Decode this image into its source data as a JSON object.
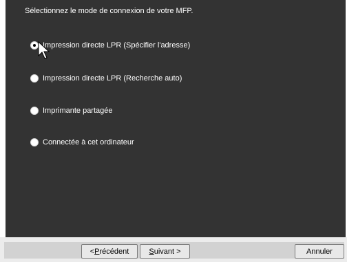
{
  "panel": {
    "instruction": "Sélectionnez le mode de connexion de votre MFP."
  },
  "options": [
    {
      "label": "Impression directe LPR (Spécifier l'adresse)",
      "selected": true
    },
    {
      "label": "Impression directe LPR (Recherche auto)",
      "selected": false
    },
    {
      "label": "Imprimante partagée",
      "selected": false
    },
    {
      "label": "Connectée à cet ordinateur",
      "selected": false
    }
  ],
  "buttons": {
    "prev": {
      "prefix": "< ",
      "mnemonic": "P",
      "rest": "récédent"
    },
    "next": {
      "mnemonic": "S",
      "rest": "uivant >"
    },
    "cancel": {
      "label": "Annuler"
    }
  },
  "cursor_icon": "arrow-cursor-icon",
  "colors": {
    "panel_background": "#333333",
    "panel_text": "#ffffff",
    "button_bar": "#ececec"
  }
}
